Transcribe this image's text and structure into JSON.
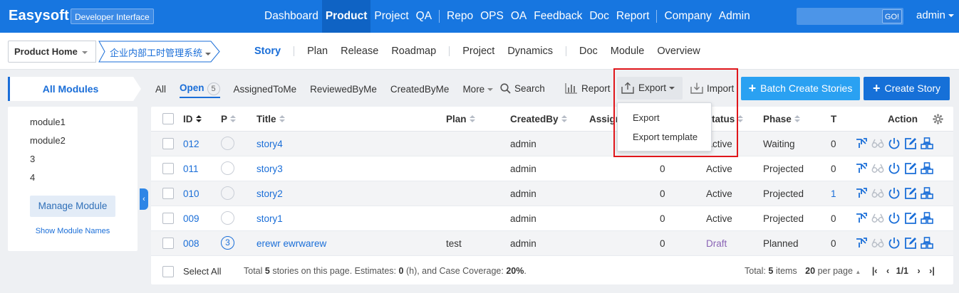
{
  "header": {
    "logo": "Easysoft",
    "subtitle": "Developer Interface",
    "nav": [
      "Dashboard",
      "Product",
      "Project",
      "QA",
      "Repo",
      "OPS",
      "OA",
      "Feedback",
      "Doc",
      "Report",
      "Company",
      "Admin"
    ],
    "active_nav": "Product",
    "search_button": "GO!",
    "user": "admin"
  },
  "subnav": {
    "product_home": "Product Home",
    "project": "企业内部工时管理系统",
    "links": [
      "Story",
      "Plan",
      "Release",
      "Roadmap",
      "Project",
      "Dynamics",
      "Doc",
      "Module",
      "Overview"
    ],
    "active": "Story"
  },
  "modules": {
    "tab": "All Modules",
    "items": [
      "module1",
      "module2",
      "3",
      "4"
    ],
    "manage": "Manage Module",
    "show_names": "Show Module Names"
  },
  "toolbar": {
    "filters": [
      "All",
      "Open",
      "AssignedToMe",
      "ReviewedByMe",
      "CreatedByMe"
    ],
    "active_filter": "Open",
    "open_count": "5",
    "more": "More",
    "search": "Search",
    "report": "Report",
    "export": "Export",
    "import": "Import",
    "batch_create": "Batch Create Stories",
    "create": "Create Story"
  },
  "export_menu": [
    "Export",
    "Export template"
  ],
  "table": {
    "columns": [
      "ID",
      "P",
      "Title",
      "Plan",
      "CreatedBy",
      "Assign",
      "Status",
      "Phase",
      "T",
      "Action"
    ],
    "rows": [
      {
        "id": "012",
        "pri": "",
        "title": "story4",
        "plan": "",
        "created_by": "admin",
        "estimate": "",
        "status": "Active",
        "phase": "Waiting",
        "t": "0"
      },
      {
        "id": "011",
        "pri": "",
        "title": "story3",
        "plan": "",
        "created_by": "admin",
        "estimate": "0",
        "status": "Active",
        "phase": "Projected",
        "t": "0"
      },
      {
        "id": "010",
        "pri": "",
        "title": "story2",
        "plan": "",
        "created_by": "admin",
        "estimate": "0",
        "status": "Active",
        "phase": "Projected",
        "t": "1"
      },
      {
        "id": "009",
        "pri": "",
        "title": "story1",
        "plan": "",
        "created_by": "admin",
        "estimate": "0",
        "status": "Active",
        "phase": "Projected",
        "t": "0"
      },
      {
        "id": "008",
        "pri": "3",
        "title": "erewr ewrwarew",
        "plan": "test",
        "created_by": "admin",
        "estimate": "0",
        "status": "Draft",
        "phase": "Planned",
        "t": "0"
      }
    ],
    "select_all": "Select All",
    "summary_prefix": "Total",
    "summary_count": "5",
    "summary_mid": "stories on this page. Estimates:",
    "summary_est": "0",
    "summary_unit": "(h), and Case Coverage:",
    "summary_cov": "20%",
    "summary_end": ".",
    "pager_total_label": "Total:",
    "pager_total": "5",
    "pager_items": "items",
    "per_page": "20",
    "per_page_label": "per page",
    "page": "1/1"
  },
  "colors": {
    "header_bg": "#1776e0",
    "accent": "#1a6ed8",
    "batch_btn": "#2aa1f2",
    "create_btn": "#1670d8",
    "highlight": "#e0161b",
    "draft": "#8a64b5"
  }
}
